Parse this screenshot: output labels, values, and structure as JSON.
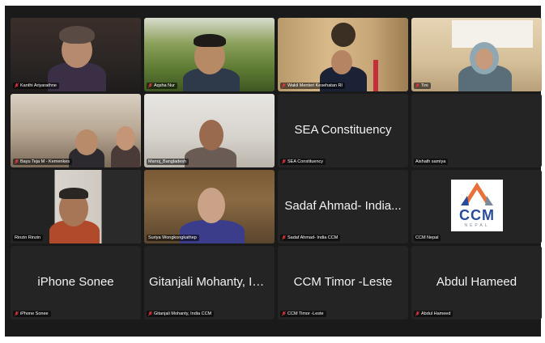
{
  "participants": [
    {
      "name": "Kanthi Ariyarathne",
      "muted": true
    },
    {
      "name": "Aqsha Nur",
      "muted": true
    },
    {
      "name": "Wakil Menteri Kesehatan RI",
      "muted": true
    },
    {
      "name": "Tini",
      "muted": true
    },
    {
      "name": "Bayu Teja M - Kemenkes",
      "muted": true
    },
    {
      "name": "Manoj_Bangladesh",
      "muted": false
    },
    {
      "name": "SEA Constituency",
      "display": "SEA Constituency",
      "muted": true
    },
    {
      "name": "Aishath samiya",
      "muted": false
    },
    {
      "name": "Rinzin Rinzin",
      "muted": false,
      "active_speaker": true
    },
    {
      "name": "Suriya Wongkongkathep",
      "muted": false
    },
    {
      "name": "Sadaf Ahmad- India CCM",
      "display": "Sadaf Ahmad- India...",
      "muted": true
    },
    {
      "name": "CCM Nepal",
      "muted": false,
      "logo_text": "CCM",
      "logo_subtext": "NEPAL"
    },
    {
      "name": "iPhone Sonee",
      "display": "iPhone Sonee",
      "muted": true
    },
    {
      "name": "Gitanjali Mohanty, India CCM",
      "display": "Gitanjali Mohanty, Ind...",
      "muted": true
    },
    {
      "name": "CCM Timor -Leste",
      "display": "CCM Timor -Leste",
      "muted": true
    },
    {
      "name": "Abdul Hameed",
      "display": "Abdul Hameed",
      "muted": true
    }
  ],
  "colors": {
    "muted_mic": "#e8383d",
    "active_border": "#3ecb5e",
    "tile_bg": "#242424",
    "ccm_blue": "#2a4b9b",
    "ccm_orange": "#e8703a"
  }
}
